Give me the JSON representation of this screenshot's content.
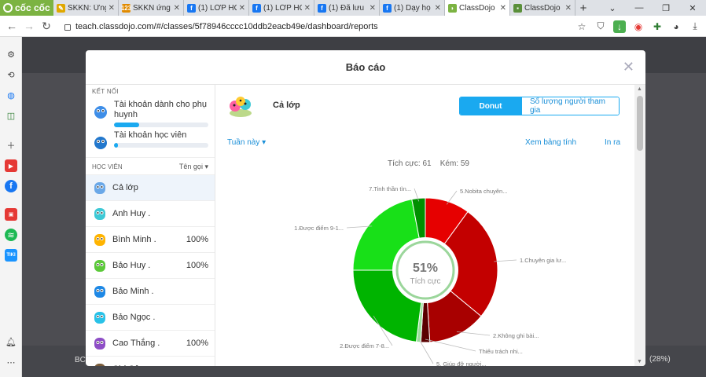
{
  "browser": {
    "brand": "cốc cốc",
    "tabs": [
      {
        "title": "SKKN: Ứng",
        "color": "#e0a800",
        "glyph": "✎",
        "active": false
      },
      {
        "title": "SKKN ứng",
        "color": "#e08a00",
        "glyph": "123",
        "active": false
      },
      {
        "title": "(1) LỚP HỌ",
        "color": "#1877f2",
        "glyph": "f",
        "active": false
      },
      {
        "title": "(1) LỚP HỌ",
        "color": "#1877f2",
        "glyph": "f",
        "active": false
      },
      {
        "title": "(1) Đã lưu",
        "color": "#1877f2",
        "glyph": "f",
        "active": false
      },
      {
        "title": "(1) Dạy họ",
        "color": "#1877f2",
        "glyph": "f",
        "active": false
      },
      {
        "title": "ClassDojo",
        "color": "#7cb342",
        "glyph": "◗",
        "active": true
      },
      {
        "title": "ClassDojo",
        "color": "#5a8f3a",
        "glyph": "▪",
        "active": false
      }
    ],
    "url": "teach.classdojo.com/#/classes/5f78946cccc10ddb2eacb49e/dashboard/reports"
  },
  "modal": {
    "title": "Báo cáo",
    "close_glyph": "✕",
    "connect_header": "KẾT NỐI",
    "accounts": [
      {
        "label": "Tài khoản dành cho phụ huynh",
        "progress": 0.27
      },
      {
        "label": "Tài khoản học viên",
        "progress": 0.03
      }
    ],
    "students_header": "HỌC VIÊN",
    "sort_label": "Tên gọi",
    "students": [
      {
        "name": "Cả lớp",
        "pct": "",
        "selected": true,
        "color": "#6aa8e8"
      },
      {
        "name": "Anh Huy .",
        "pct": "",
        "selected": false,
        "color": "#3ec9d6"
      },
      {
        "name": "Bình Minh .",
        "pct": "100%",
        "selected": false,
        "color": "#ffb400"
      },
      {
        "name": "Bảo Huy .",
        "pct": "100%",
        "selected": false,
        "color": "#5cc93a"
      },
      {
        "name": "Bảo Minh .",
        "pct": "",
        "selected": false,
        "color": "#1e88e5"
      },
      {
        "name": "Bảo Ngọc .",
        "pct": "",
        "selected": false,
        "color": "#29c2e8"
      },
      {
        "name": "Cao Thắng .",
        "pct": "100%",
        "selected": false,
        "color": "#8e4ec6"
      },
      {
        "name": "Chí Công .",
        "pct": "",
        "selected": false,
        "color": "#7a5c3a"
      }
    ],
    "class_name": "Cả lớp",
    "view_tabs": {
      "donut": "Donut",
      "participation": "Số lượng người tham gia"
    },
    "period": "Tuần này",
    "view_table": "Xem bảng tính",
    "print": "In ra",
    "positive_label": "Tích cực:",
    "positive_count": "61",
    "negative_label": "Kém:",
    "negative_count": "59"
  },
  "chart_data": {
    "type": "pie",
    "center_value": "51%",
    "center_label": "Tích cực",
    "slices": [
      {
        "label": "5.Nobita chuyên...",
        "value": 10,
        "color": "#e60000"
      },
      {
        "label": "1.Chuyên gia lư...",
        "value": 26,
        "color": "#c30000"
      },
      {
        "label": "2.Không ghi bài...",
        "value": 13,
        "color": "#a80000"
      },
      {
        "label": "Thiếu trách nhi...",
        "value": 2,
        "color": "#5a0000"
      },
      {
        "label": "5. Giúp đỡ người...",
        "value": 1,
        "color": "#9adf9a"
      },
      {
        "label": "2.Được điểm 7-8...",
        "value": 23,
        "color": "#00b400"
      },
      {
        "label": "1.Được điểm 9-1...",
        "value": 22,
        "color": "#18e018"
      },
      {
        "label": "7.Tinh thần tìn...",
        "value": 3,
        "color": "#009000"
      }
    ]
  },
  "background": {
    "footer_label": "BC",
    "footer_pct": "(28%)"
  }
}
